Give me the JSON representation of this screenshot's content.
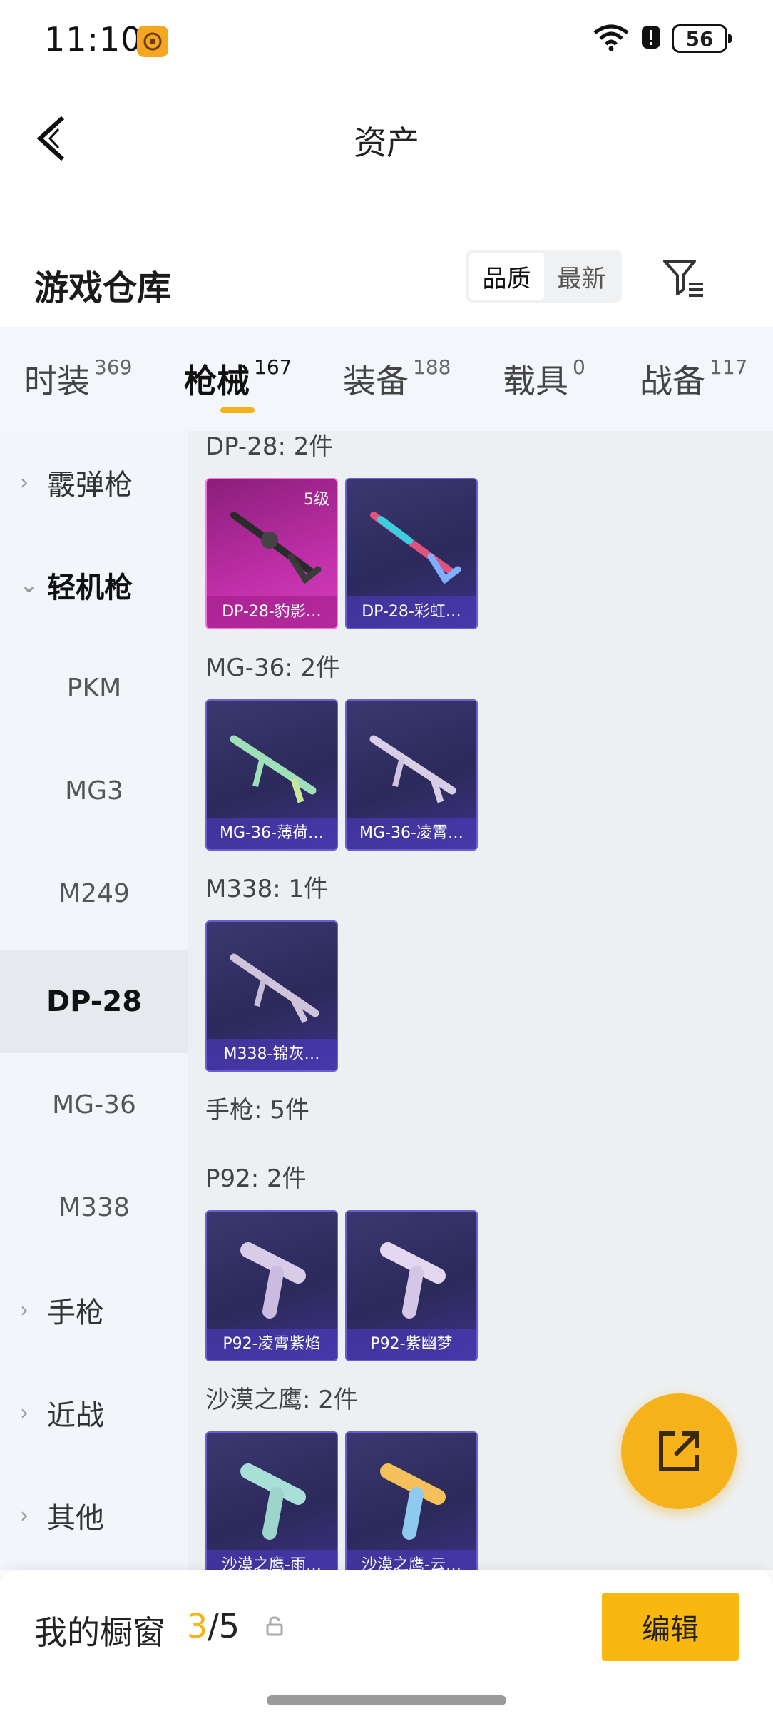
{
  "status_bar": {
    "time": "11:10",
    "battery": "56"
  },
  "header": {
    "title": "资产"
  },
  "warehouse": {
    "title": "游戏仓库",
    "sort_options": [
      "品质",
      "最新"
    ],
    "active_sort": "品质"
  },
  "tabs": [
    {
      "label": "时装",
      "count": "369"
    },
    {
      "label": "枪械",
      "count": "167"
    },
    {
      "label": "装备",
      "count": "188"
    },
    {
      "label": "载具",
      "count": "0"
    },
    {
      "label": "战备",
      "count": "117"
    }
  ],
  "active_tab": "枪械",
  "sidebar": {
    "items": [
      {
        "label": "霰弹枪",
        "type": "group"
      },
      {
        "label": "轻机枪",
        "type": "group-open"
      },
      {
        "label": "PKM",
        "type": "sub"
      },
      {
        "label": "MG3",
        "type": "sub"
      },
      {
        "label": "M249",
        "type": "sub"
      },
      {
        "label": "DP-28",
        "type": "sub-active"
      },
      {
        "label": "MG-36",
        "type": "sub"
      },
      {
        "label": "M338",
        "type": "sub"
      },
      {
        "label": "手枪",
        "type": "group"
      },
      {
        "label": "近战",
        "type": "group"
      },
      {
        "label": "其他",
        "type": "group"
      }
    ]
  },
  "sections": [
    {
      "label": "DP-28: 2件",
      "items": [
        {
          "name": "DP-28-豹影…",
          "level": "5级",
          "style": "gold"
        },
        {
          "name": "DP-28-彩虹…"
        }
      ]
    },
    {
      "label": "MG-36: 2件",
      "items": [
        {
          "name": "MG-36-薄荷…"
        },
        {
          "name": "MG-36-凌霄…"
        }
      ]
    },
    {
      "label": "M338: 1件",
      "items": [
        {
          "name": "M338-锦灰…"
        }
      ]
    },
    {
      "label": "手枪: 5件",
      "items": []
    },
    {
      "label": "P92: 2件",
      "items": [
        {
          "name": "P92-凌霄紫焰"
        },
        {
          "name": "P92-紫幽梦"
        }
      ]
    },
    {
      "label": "沙漠之鹰: 2件",
      "items": [
        {
          "name": "沙漠之鹰-雨…"
        },
        {
          "name": "沙漠之鹰-云…"
        }
      ]
    }
  ],
  "bottom": {
    "showcase_label": "我的橱窗",
    "showcase_current": "3",
    "showcase_total": "/5",
    "edit_label": "编辑"
  },
  "colors": {
    "accent": "#f5b21b",
    "card_purple": "#2c2a5a",
    "card_gold": "#c02fa8"
  }
}
